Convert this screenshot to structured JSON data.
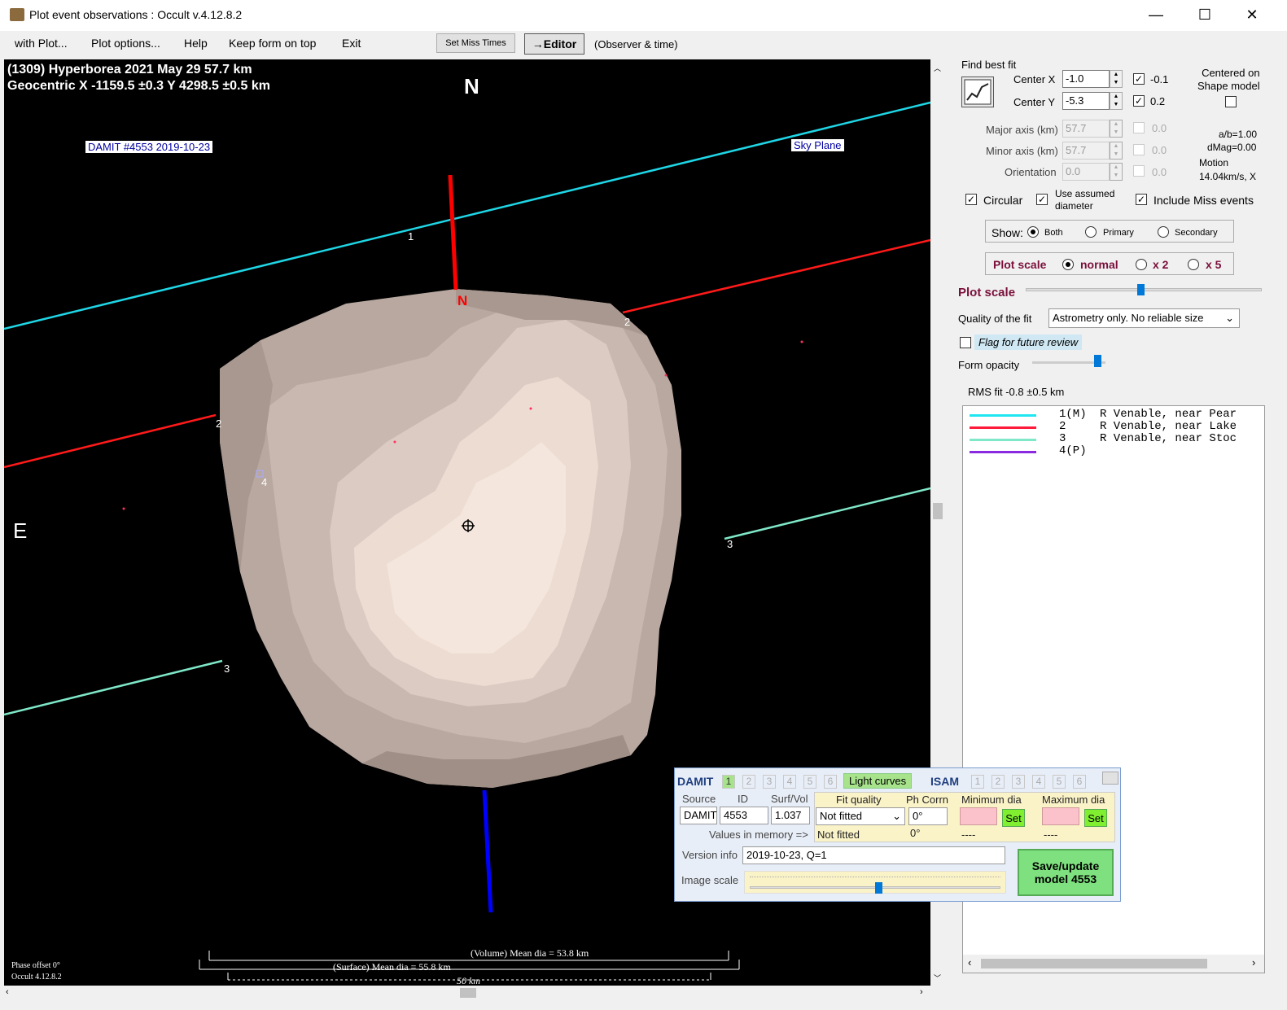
{
  "window": {
    "title": "Plot event observations : Occult v.4.12.8.2",
    "minimize": "—",
    "maximize": "☐",
    "close": "✕"
  },
  "menu": {
    "items": [
      "with Plot...",
      "Plot options...",
      "Help",
      "Keep form on top",
      "Exit"
    ],
    "set_miss_times": "Set Miss Times",
    "editor": "→Editor",
    "observer_time": "(Observer & time)"
  },
  "plot": {
    "header_line1": "(1309) Hyperborea  2021 May 29   57.7 km",
    "header_line2": "Geocentric  X  -1159.5 ±0.3  Y 4298.5 ±0.5 km",
    "north_label": "N",
    "east_label": "E",
    "pole_label": "N",
    "damit_tag": "DAMIT #4553 2019-10-23",
    "sky_plane_tag": "Sky Plane",
    "chord_labels": [
      "1",
      "2",
      "2",
      "3",
      "3",
      "4"
    ],
    "volume_dia": "(Volume) Mean dia = 53.8 km",
    "surface_dia": "(Surface) Mean dia = 55.8 km",
    "scale_bar": "50 km",
    "phase_offset": "Phase offset 0°",
    "version": "Occult 4.12.8.2",
    "colors": {
      "chord1": "#1fd6e6",
      "chord2": "#ff1a1a",
      "chord3": "#7fe8c8",
      "pole_n": "#ff0000",
      "pole_s": "#0000ff"
    }
  },
  "panel": {
    "find_best_fit": "Find best fit",
    "center_x_label": "Center X",
    "center_x": "-1.0",
    "center_x_step": "-0.1",
    "center_y_label": "Center Y",
    "center_y": "-5.3",
    "center_y_step": "0.2",
    "centered_on_shape": "Centered on\nShape model",
    "major_axis_label": "Major axis (km)",
    "major_axis": "57.7",
    "major_step": "0.0",
    "minor_axis_label": "Minor axis (km)",
    "minor_axis": "57.7",
    "minor_step": "0.0",
    "orientation_label": "Orientation",
    "orientation": "0.0",
    "orientation_step": "0.0",
    "ab_ratio": "a/b=1.00",
    "dmag": "dMag=0.00",
    "motion_label": "Motion",
    "motion_value": "14.04km/s, X",
    "circular": "Circular",
    "use_assumed": "Use assumed diameter",
    "include_miss": "Include Miss events",
    "show_label": "Show:",
    "show_options": [
      "Both",
      "Primary",
      "Secondary"
    ],
    "plot_scale_group": "Plot scale",
    "plot_scale_options": [
      "normal",
      "x 2",
      "x 5"
    ],
    "plot_scale_slider": "Plot scale",
    "quality_label": "Quality of the fit",
    "quality_value": "Astrometry only. No reliable size",
    "flag_review": "Flag for future review",
    "form_opacity": "Form opacity",
    "rms_fit": "RMS fit -0.8 ±0.5 km",
    "legend": [
      {
        "id": "1(M)",
        "text": "R Venable, near Pear",
        "color": "#1fe6f0"
      },
      {
        "id": "2",
        "text": "R Venable, near Lake",
        "color": "#ff1a3a"
      },
      {
        "id": "3",
        "text": "R Venable, near Stoc",
        "color": "#7fe8c8"
      },
      {
        "id": "4(P)",
        "text": "",
        "color": "#8a2be2"
      }
    ]
  },
  "damit_panel": {
    "damit_label": "DAMIT",
    "tabs": [
      "1",
      "2",
      "3",
      "4",
      "5",
      "6"
    ],
    "light_curves": "Light curves",
    "isam_label": "ISAM",
    "isam_tabs": [
      "1",
      "2",
      "3",
      "4",
      "5",
      "6"
    ],
    "source_label": "Source",
    "id_label": "ID",
    "surfvol_label": "Surf/Vol",
    "source": "DAMIT",
    "id": "4553",
    "surfvol": "1.037",
    "fit_quality_label": "Fit quality",
    "ph_corr_label": "Ph Corrn",
    "min_dia_label": "Minimum dia",
    "max_dia_label": "Maximum dia",
    "fit_quality": "Not fitted",
    "ph_corr": "0°",
    "set": "Set",
    "values_in_memory": "Values in memory =>",
    "mem_fit": "Not fitted",
    "mem_ph": "0°",
    "mem_min": "----",
    "mem_max": "----",
    "version_info_label": "Version info",
    "version_info": "2019-10-23, Q=1",
    "image_scale_label": "Image scale",
    "save_button": "Save/update\nmodel 4553"
  }
}
